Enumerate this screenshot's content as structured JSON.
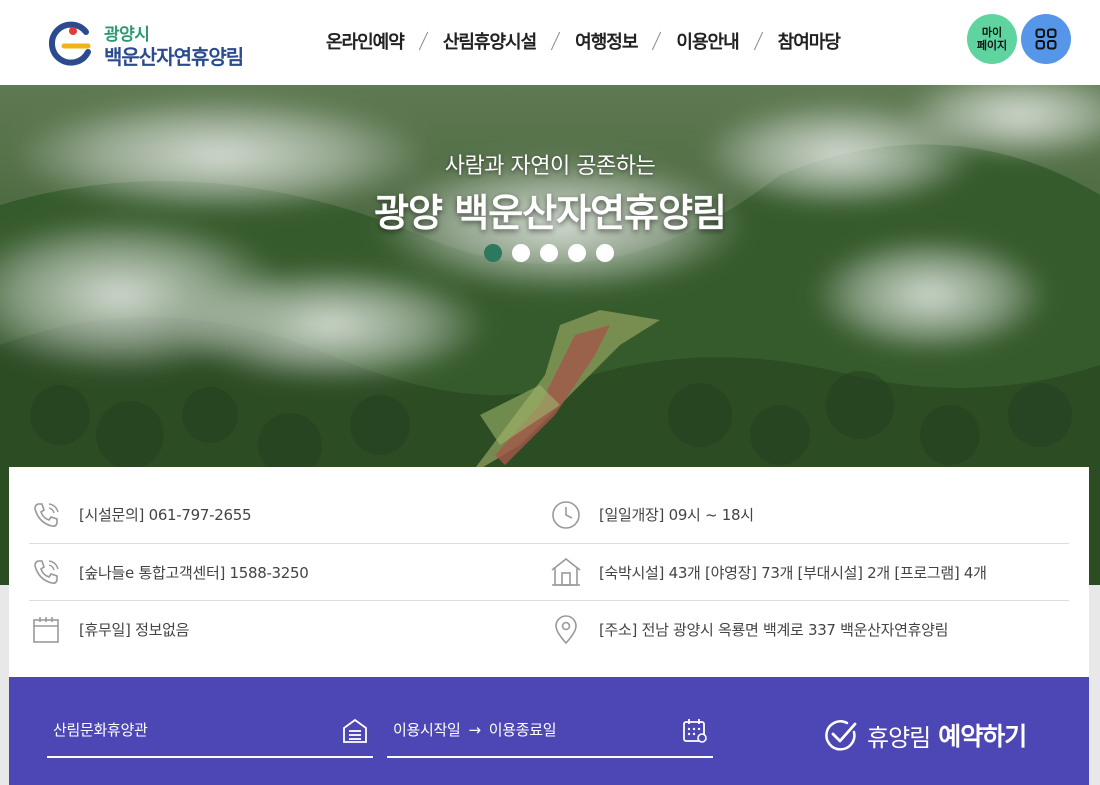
{
  "header": {
    "logo_city": "광양시",
    "logo_name": "백운산자연휴양림",
    "nav": [
      "온라인예약",
      "산림휴양시설",
      "여행정보",
      "이용안내",
      "참여마당"
    ],
    "my_page_line1": "마이",
    "my_page_line2": "페이지",
    "menu_icon": "grid-icon"
  },
  "hero": {
    "subtitle": "사람과 자연이 공존하는",
    "title": "광양 백운산자연휴양림",
    "slides": 5,
    "active_slide": 1
  },
  "info": {
    "phone": "[시설문의] 061-797-2655",
    "hours": "[일일개장] 09시 ~ 18시",
    "center": "[숲나들e 통합고객센터] 1588-3250",
    "facilities": "[숙박시설] 43개 [야영장] 73개 [부대시설] 2개 [프로그램] 4개",
    "holiday": "[휴무일] 정보없음",
    "address": "[주소] 전남 광양시 옥룡면 백계로 337 백운산자연휴양림"
  },
  "booking": {
    "facility_value": "산림문화휴양관",
    "start_placeholder": "이용시작일",
    "arrow": "→",
    "end_placeholder": "이용종료일",
    "button_light": "휴양림",
    "button_bold": "예약하기"
  },
  "colors": {
    "brand_green": "#2d9a74",
    "brand_navy": "#2b4b8e",
    "booking_bg": "#4d47b6",
    "my_page_btn": "#5fd4a0",
    "menu_btn": "#5596e8",
    "active_dot": "#2b7a5e"
  }
}
